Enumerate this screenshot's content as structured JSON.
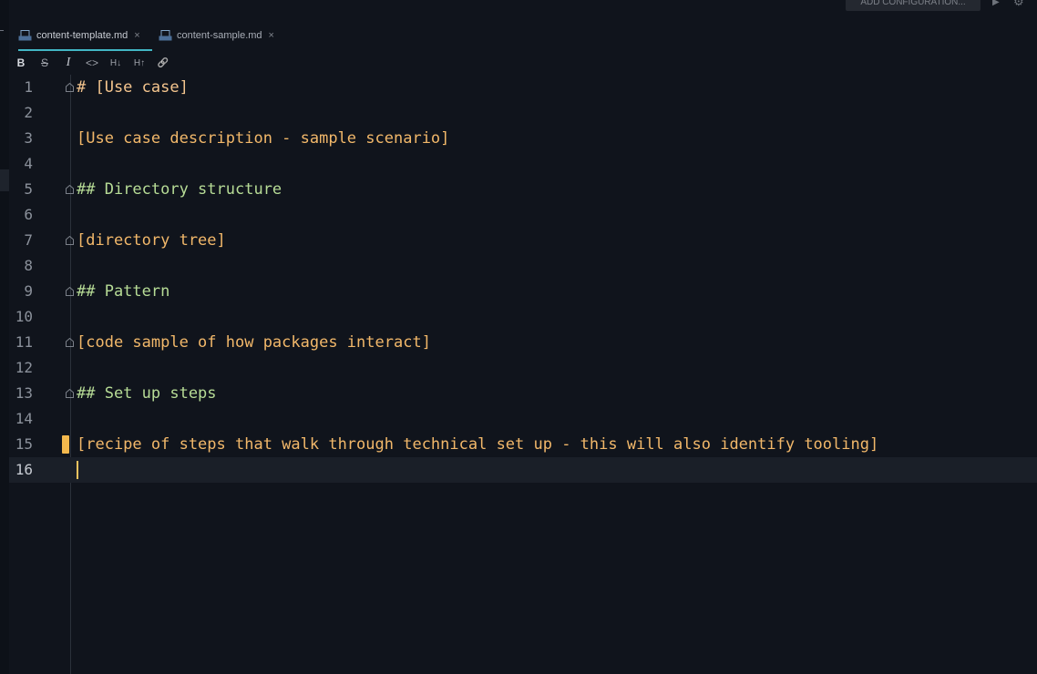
{
  "topbar": {
    "run_config_label": "ADD CONFIGURATION...",
    "run_icon": "▶",
    "settings_icon": "⚙"
  },
  "tabs": [
    {
      "label": "content-template.md",
      "close": "×",
      "active": true
    },
    {
      "label": "content-sample.md",
      "close": "×",
      "active": false
    }
  ],
  "toolbar": {
    "bold": "B",
    "strikethrough": "S",
    "italic": "I",
    "code": "<>",
    "header_decrease": "H↓",
    "header_increase": "H↑",
    "link": "🔗"
  },
  "editor": {
    "current_line": 16,
    "lines": [
      {
        "num": "1",
        "text": "# [Use case]"
      },
      {
        "num": "2",
        "text": ""
      },
      {
        "num": "3",
        "text": "[Use case description - sample scenario]"
      },
      {
        "num": "4",
        "text": ""
      },
      {
        "num": "5",
        "text": "## Directory structure"
      },
      {
        "num": "6",
        "text": ""
      },
      {
        "num": "7",
        "text": "[directory tree]"
      },
      {
        "num": "8",
        "text": ""
      },
      {
        "num": "9",
        "text": "## Pattern"
      },
      {
        "num": "10",
        "text": ""
      },
      {
        "num": "11",
        "text": "[code sample of how packages interact]"
      },
      {
        "num": "12",
        "text": ""
      },
      {
        "num": "13",
        "text": "## Set up steps"
      },
      {
        "num": "14",
        "text": ""
      },
      {
        "num": "15",
        "text": "[recipe of steps that walk through technical set up - this will also identify tooling]"
      },
      {
        "num": "16",
        "text": ""
      }
    ]
  },
  "colors": {
    "background": "#10141c",
    "current_line": "#1a1f28",
    "heading1": "#f4c58e",
    "heading2": "#b7dc96",
    "text": "#f2b86a",
    "tab_accent": "#42b6c4",
    "caret": "#f3c35f"
  }
}
